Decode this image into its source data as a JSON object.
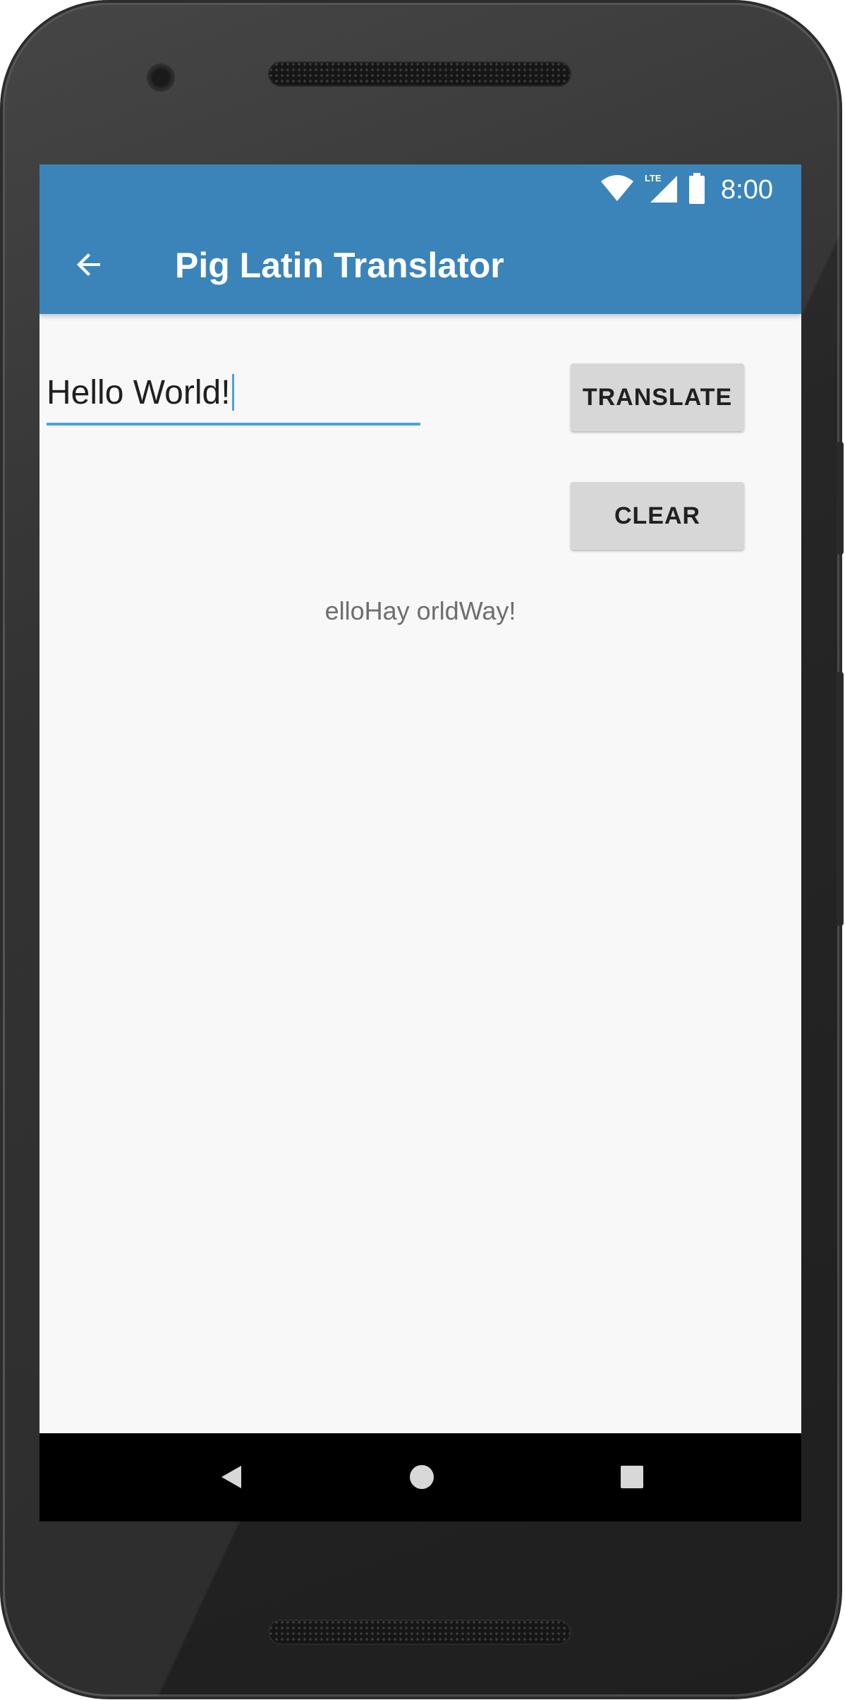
{
  "status_bar": {
    "time": "8:00",
    "network_label": "LTE",
    "icons": [
      "wifi-icon",
      "lte-signal-icon",
      "battery-icon"
    ]
  },
  "app_bar": {
    "title": "Pig Latin Translator",
    "back_icon": "arrow-back-icon"
  },
  "form": {
    "input_value": "Hello World!",
    "translate_label": "TRANSLATE",
    "clear_label": "CLEAR",
    "output": "elloHay orldWay!"
  },
  "nav_bar": {
    "icons": [
      "nav-back-icon",
      "nav-home-icon",
      "nav-recents-icon"
    ]
  },
  "colors": {
    "primary": "#3a84ba",
    "accent": "#4aa3df",
    "background": "#f8f8f8",
    "button": "#d6d7d6"
  }
}
